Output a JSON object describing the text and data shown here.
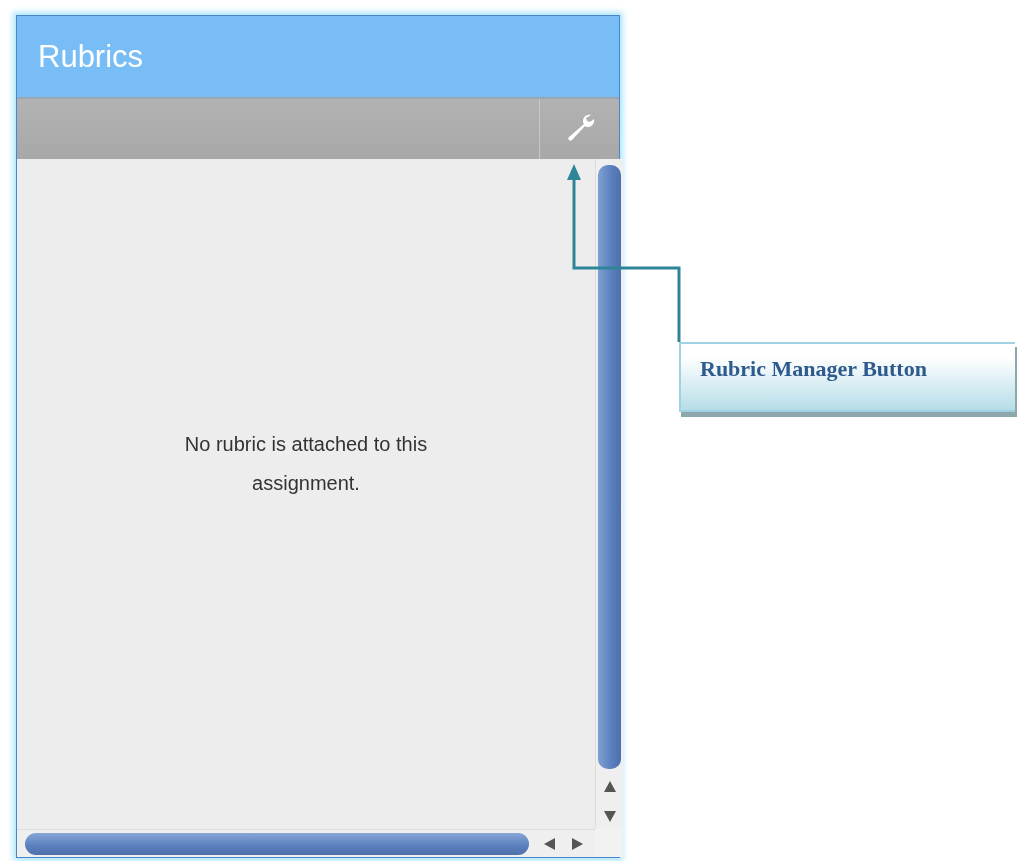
{
  "panel": {
    "title": "Rubrics",
    "message": "No rubric is attached to this assignment."
  },
  "callout": {
    "label": "Rubric Manager Button"
  }
}
